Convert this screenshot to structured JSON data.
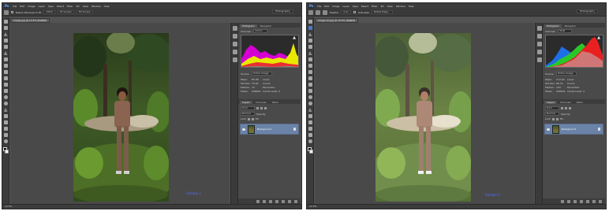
{
  "app": {
    "logo": "Ps",
    "menu": [
      "File",
      "Edit",
      "Image",
      "Layer",
      "Type",
      "Select",
      "Filter",
      "3D",
      "View",
      "Window",
      "Help"
    ],
    "workspace": "Photography"
  },
  "screens": [
    {
      "options": {
        "tool": "zoom",
        "fields": [
          "Resize Windows to Fit",
          "100%",
          "Fit Screen",
          "Fill Screen"
        ]
      },
      "doc_tab": "Image.jpg @ 12.5% (RGB/8)",
      "status": "12.5%",
      "watermark": "Sample 1",
      "histogram": {
        "tabs": [
          "Histogram",
          "Navigator"
        ],
        "channel_label": "Channel:",
        "channel": "Colors",
        "style": "colors"
      },
      "stats": {
        "source_label": "Source:",
        "source": "Entire Image",
        "rows": [
          [
            "Mean:",
            "85.38",
            "Level:",
            ""
          ],
          [
            "Std Dev:",
            "70.05",
            "Count:",
            ""
          ],
          [
            "Median:",
            "72",
            "Percentile:",
            ""
          ],
          [
            "Pixels:",
            "948923",
            "Cache Level:",
            "4"
          ]
        ]
      },
      "layers": {
        "tabs": [
          "Layers",
          "Channels",
          "Paths"
        ],
        "kind": "Kind",
        "mode": "Normal",
        "opacity": "Opacity",
        "lock": "Lock",
        "fill": "Fill",
        "layer_name": "Background"
      },
      "accent": "#f000f0"
    },
    {
      "options": {
        "tool": "lasso",
        "fields": [
          "Feather",
          "0 px",
          "Anti-alias",
          "Refine Edge..."
        ]
      },
      "doc_tab": "Image (2).jpg @ 12.5% (RGB/8)",
      "status": "12.5%",
      "watermark": "Sample 2",
      "histogram": {
        "tabs": [
          "Histogram",
          "Navigator"
        ],
        "channel_label": "Channel:",
        "channel": "RGB",
        "style": "rgb"
      },
      "stats": {
        "source_label": "Source:",
        "source": "Entire Image",
        "rows": [
          [
            "Mean:",
            "112.03",
            "Level:",
            ""
          ],
          [
            "Std Dev:",
            "66.74",
            "Count:",
            ""
          ],
          [
            "Median:",
            "104",
            "Percentile:",
            ""
          ],
          [
            "Pixels:",
            "948923",
            "Cache Level:",
            "4"
          ]
        ]
      },
      "layers": {
        "tabs": [
          "Layers",
          "Channels",
          "Paths"
        ],
        "kind": "Kind",
        "mode": "Normal",
        "opacity": "Opacity",
        "lock": "Lock",
        "fill": "Fill",
        "layer_name": "Background"
      },
      "accent": "#2a5cff"
    }
  ]
}
